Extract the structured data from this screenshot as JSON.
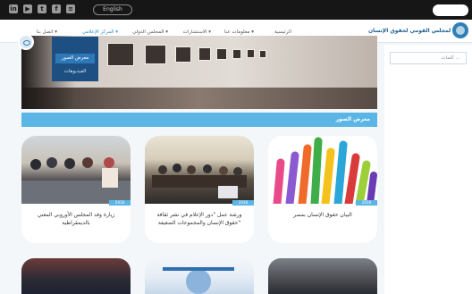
{
  "topbar": {
    "social_icons": [
      "linkedin-icon",
      "youtube-icon",
      "twitter-icon",
      "facebook-icon",
      "rss-icon"
    ],
    "social_glyphs": [
      "in",
      "▶",
      "t",
      "f",
      "≡"
    ],
    "lang_button": "English",
    "search_placeholder": ""
  },
  "header": {
    "logo_text": "المجلس القومي لحقوق الإنسان",
    "nav": [
      {
        "label": "الرئيسية",
        "active": false
      },
      {
        "label": "معلومات عنا ▾",
        "active": false
      },
      {
        "label": "الاستشارات ▾",
        "active": false
      },
      {
        "label": "المجلس الدولي ▾",
        "active": false
      },
      {
        "label": "المركز الإعلامي ▾",
        "active": true
      },
      {
        "label": "اتصل بنا ▾",
        "active": false
      }
    ]
  },
  "dropdown": {
    "items": [
      "",
      "معرض الصور",
      "الفيديوهات"
    ]
  },
  "sidebar": {
    "search_placeholder": "كلمات ..."
  },
  "section": {
    "title": "معرض الصور"
  },
  "cards": [
    {
      "title": "البيان حقوق الإنسان بمصر",
      "tag": "2018"
    },
    {
      "title": "ورشة عمل \"دور الإعلام في نشر ثقافة حقوق الإنسان والمجموعات الضعيفة\"",
      "tag": "2018"
    },
    {
      "title": "زيارة وفد المجلس الأوروبي المعني بالديمقراطية",
      "tag": "2018"
    }
  ],
  "colors": {
    "accent": "#5bb6e6",
    "brand": "#1b5f8f",
    "dropdown_bg": "#1e4f82",
    "topbar_bg": "#161616"
  }
}
